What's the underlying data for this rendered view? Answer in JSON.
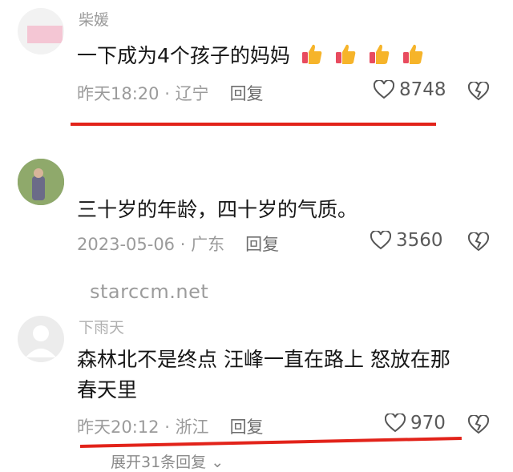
{
  "comments": [
    {
      "username": "柴媛",
      "text": "一下成为4个孩子的妈妈",
      "emoji": [
        "thumbs-up-icon",
        "thumbs-up-icon",
        "thumbs-up-icon",
        "thumbs-up-icon"
      ],
      "time": "昨天18:20",
      "location": "辽宁",
      "reply": "回复",
      "likes": "8748"
    },
    {
      "username": "",
      "text": "三十岁的年龄，四十岁的气质。",
      "time": "2023-05-06",
      "location": "广东",
      "reply": "回复",
      "likes": "3560"
    },
    {
      "username": "下雨天",
      "text_line1": "森林北不是终点  汪峰一直在路上  怒放在那",
      "text_line2": "春天里",
      "time": "昨天20:12",
      "location": "浙江",
      "reply": "回复",
      "likes": "970"
    }
  ],
  "separator": " · ",
  "watermark": "starccm.net",
  "expand_label": "展开31条回复",
  "colors": {
    "underline": "#e2231a",
    "meta": "#9b9b9b",
    "text": "#161616"
  }
}
